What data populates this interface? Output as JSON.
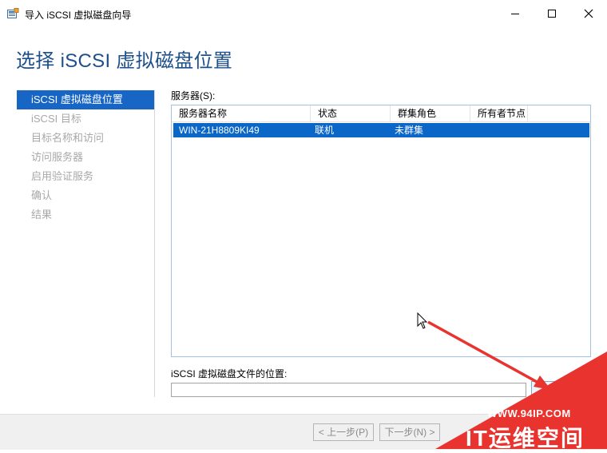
{
  "window": {
    "title": "导入 iSCSI 虚拟磁盘向导",
    "controls": [
      "minimize",
      "maximize",
      "close"
    ]
  },
  "page_title": "选择 iSCSI 虚拟磁盘位置",
  "nav": {
    "items": [
      {
        "label": "iSCSI 虚拟磁盘位置",
        "active": true
      },
      {
        "label": "iSCSI 目标",
        "active": false
      },
      {
        "label": "目标名称和访问",
        "active": false
      },
      {
        "label": "访问服务器",
        "active": false
      },
      {
        "label": "启用验证服务",
        "active": false
      },
      {
        "label": "确认",
        "active": false
      },
      {
        "label": "结果",
        "active": false
      }
    ]
  },
  "servers": {
    "label": "服务器(S):",
    "columns": [
      "服务器名称",
      "状态",
      "群集角色",
      "所有者节点"
    ],
    "rows": [
      {
        "name": "WIN-21H8809KI49",
        "status": "联机",
        "role": "未群集",
        "owner": ""
      }
    ]
  },
  "path": {
    "label": "iSCSI 虚拟磁盘文件的位置:",
    "value": ""
  },
  "footer": {
    "prev_label": "< 上一步(P)",
    "next_label": "下一步(N) >"
  },
  "watermark": {
    "url": "WWW.94IP.COM",
    "brand": "IT运维空间"
  },
  "colors": {
    "accent": "#1766c6",
    "title": "#1c4f8c",
    "watermark": "#e8332f"
  }
}
